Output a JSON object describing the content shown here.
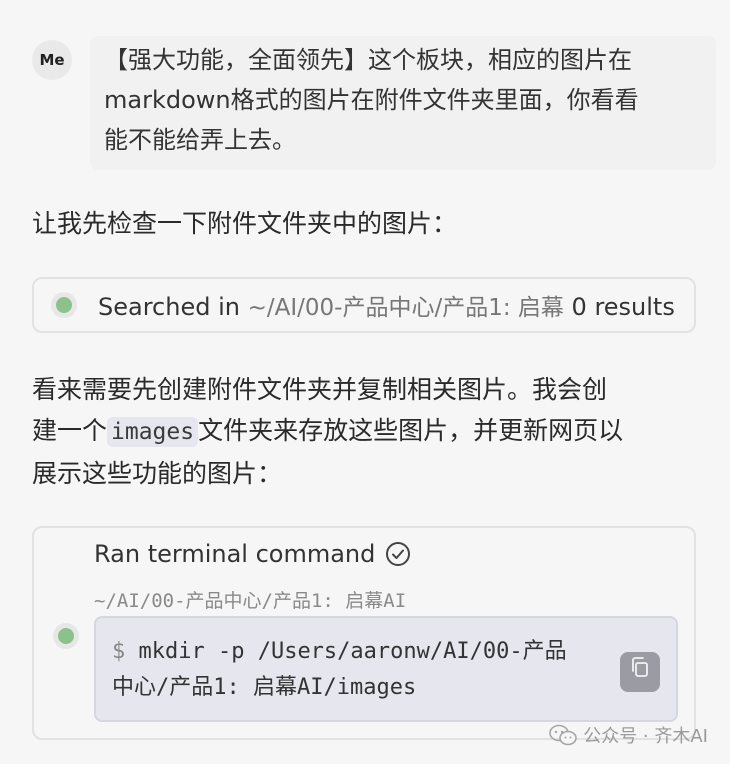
{
  "user_message": {
    "avatar_text": "Me",
    "line1": "【强大功能，全面领先】这个板块，相应的图片在",
    "line2": "markdown格式的图片在附件文件夹里面，你看看",
    "line3": "能不能给弄上去。"
  },
  "assistant": {
    "intro": "让我先检查一下附件文件夹中的图片：",
    "search": {
      "prefix": "Searched in",
      "path": "~/AI/00-产品中心/产品1: 启幕",
      "result": "0 results",
      "status_color": "#8bc28b"
    },
    "explain_part1": "看来需要先创建附件文件夹并复制相关图片。我会创",
    "explain_part2": "建一个",
    "explain_code": "images",
    "explain_part3": "文件夹来存放这些图片，并更新网页以",
    "explain_part4": "展示这些功能的图片：",
    "terminal": {
      "title": "Ran terminal command",
      "cwd": "~/AI/00-产品中心/产品1: 启幕AI",
      "prompt": "$",
      "command_line1": "mkdir -p /Users/aaronw/AI/00-产品",
      "command_line2": "中心/产品1: 启幕AI/images"
    }
  },
  "watermark": {
    "text": "公众号 · 齐木AI"
  }
}
